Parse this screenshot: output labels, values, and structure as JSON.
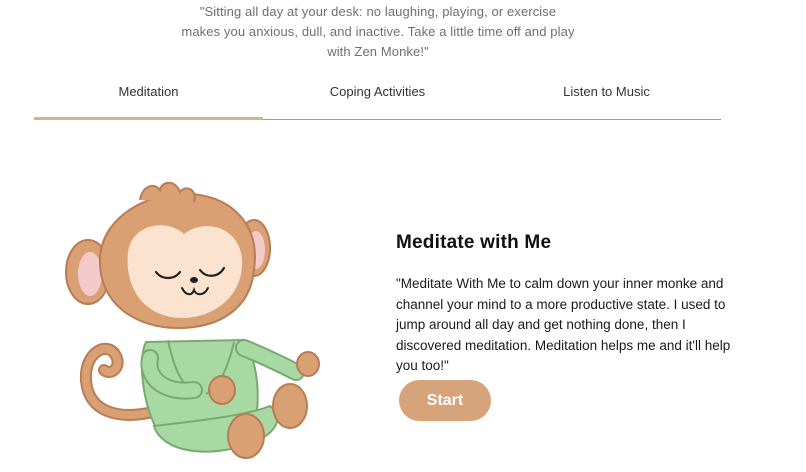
{
  "intro": {
    "quote": "\"Sitting all day at your desk: no laughing, playing, or exercise makes you anxious, dull, and inactive. Take a little time off and play with Zen Monke!\""
  },
  "tabs": [
    {
      "label": "Meditation",
      "active": true
    },
    {
      "label": "Coping Activities",
      "active": false
    },
    {
      "label": "Listen to Music",
      "active": false
    }
  ],
  "section": {
    "title": "Meditate with Me",
    "description": "\"Meditate With Me to calm down your inner monke and channel your mind to a more productive state. I used to jump around all day and get nothing done, then I discovered meditation. Meditation helps me and it'll help you too!\"",
    "start_label": "Start"
  },
  "colors": {
    "accent": "#d7a37a",
    "tab_active_underline": "#d8b08a",
    "hoodie": "#a8d9a2",
    "monkey_fur": "#d9a074",
    "monkey_face": "#fbe3cf"
  },
  "icons": {
    "illustration": "meditating-monkey-illustration"
  }
}
